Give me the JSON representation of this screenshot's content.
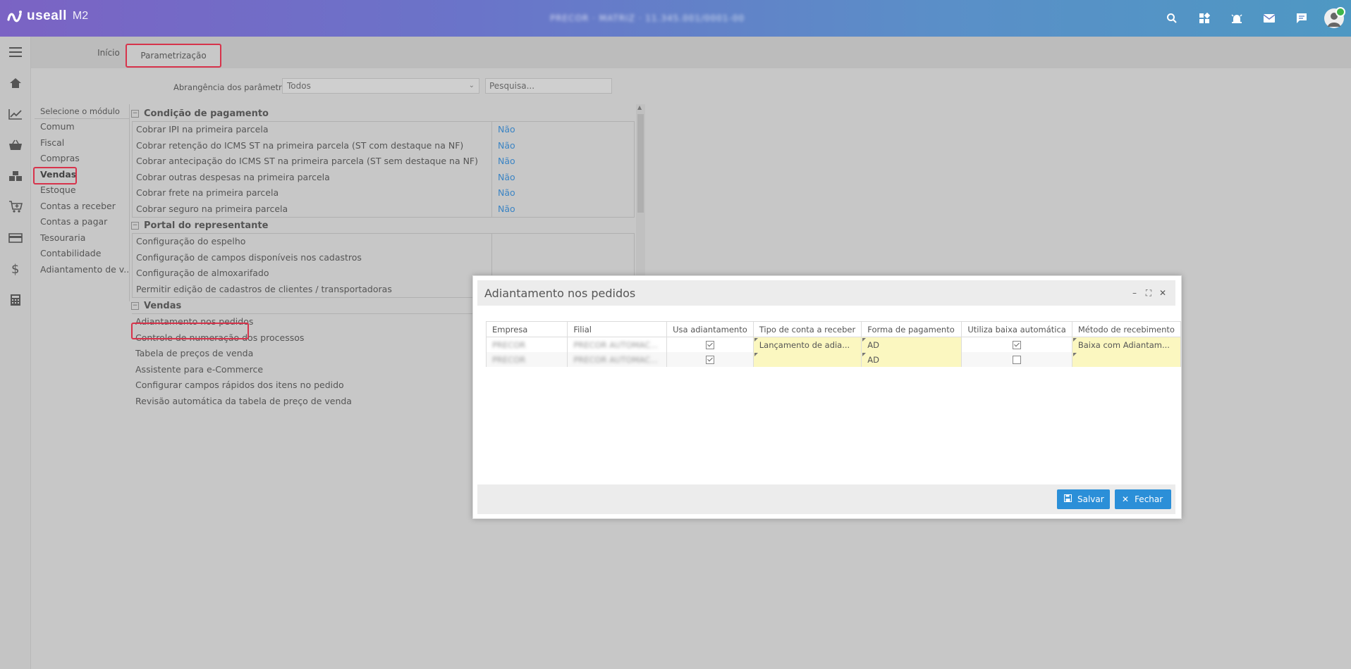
{
  "app": {
    "brand": "useall",
    "brand_sub": "M2",
    "context_text": "PRECOR · MATRIZ · 11.345.001/0001-00"
  },
  "top_icons": [
    "search-icon",
    "apps-icon",
    "alarm-icon",
    "mail-icon",
    "chat-icon"
  ],
  "tabs": [
    {
      "label": "Início"
    },
    {
      "label": "Parametrização",
      "active": true
    }
  ],
  "filter": {
    "label": "Abrangência dos parâmetros",
    "value": "Todos",
    "search_placeholder": "Pesquisa..."
  },
  "modules": {
    "header": "Selecione o módulo",
    "items": [
      "Comum",
      "Fiscal",
      "Compras",
      "Vendas",
      "Estoque",
      "Contas a receber",
      "Contas a pagar",
      "Tesouraria",
      "Contabilidade",
      "Adiantamento de v..."
    ],
    "selected": "Vendas"
  },
  "sections": [
    {
      "title": "Condição de pagamento",
      "rows": [
        {
          "name": "Cobrar IPI na primeira parcela",
          "value": "Não"
        },
        {
          "name": "Cobrar retenção do ICMS ST na primeira parcela (ST com destaque na NF)",
          "value": "Não"
        },
        {
          "name": "Cobrar antecipação do ICMS ST na primeira parcela (ST sem destaque na NF)",
          "value": "Não"
        },
        {
          "name": "Cobrar outras despesas na primeira parcela",
          "value": "Não"
        },
        {
          "name": "Cobrar frete na primeira parcela",
          "value": "Não"
        },
        {
          "name": "Cobrar seguro na primeira parcela",
          "value": "Não"
        }
      ]
    },
    {
      "title": "Portal do representante",
      "rows": [
        {
          "name": "Configuração do espelho",
          "value": ""
        },
        {
          "name": "Configuração de campos disponíveis nos cadastros",
          "value": ""
        },
        {
          "name": "Configuração de almoxarifado",
          "value": ""
        },
        {
          "name": "Permitir edição de cadastros de clientes / transportadoras",
          "value": ""
        }
      ]
    },
    {
      "title": "Vendas",
      "rows": [
        {
          "name": "Adiantamento nos pedidos"
        },
        {
          "name": "Controle de numeração dos processos"
        },
        {
          "name": "Tabela de preços de venda"
        },
        {
          "name": "Assistente para e-Commerce"
        },
        {
          "name": "Configurar campos rápidos dos itens no pedido"
        },
        {
          "name": "Revisão automática da tabela de preço de venda"
        }
      ]
    }
  ],
  "modal": {
    "title": "Adiantamento nos pedidos",
    "columns": [
      "Empresa",
      "Filial",
      "Usa adiantamento",
      "Tipo de conta a receber",
      "Forma de pagamento",
      "Utiliza baixa automática",
      "Método de recebimento"
    ],
    "rows": [
      {
        "empresa": "PRECOR",
        "filial": "PRECOR AUTOMAC...",
        "usa_adiantamento": true,
        "tipo_conta": "Lançamento de adia...",
        "forma_pagamento": "AD",
        "baixa_automatica": true,
        "metodo": "Baixa com Adiantam..."
      },
      {
        "empresa": "PRECOR",
        "filial": "PRECOR AUTOMAC...",
        "usa_adiantamento": true,
        "tipo_conta": "",
        "forma_pagamento": "AD",
        "baixa_automatica": false,
        "metodo": ""
      }
    ],
    "buttons": {
      "save": "Salvar",
      "close": "Fechar"
    }
  },
  "colors": {
    "accent": "#2b8fd8",
    "highlight_border": "#d7334b",
    "value_link": "#3b84c4",
    "editable_cell": "#fbf7c0"
  }
}
